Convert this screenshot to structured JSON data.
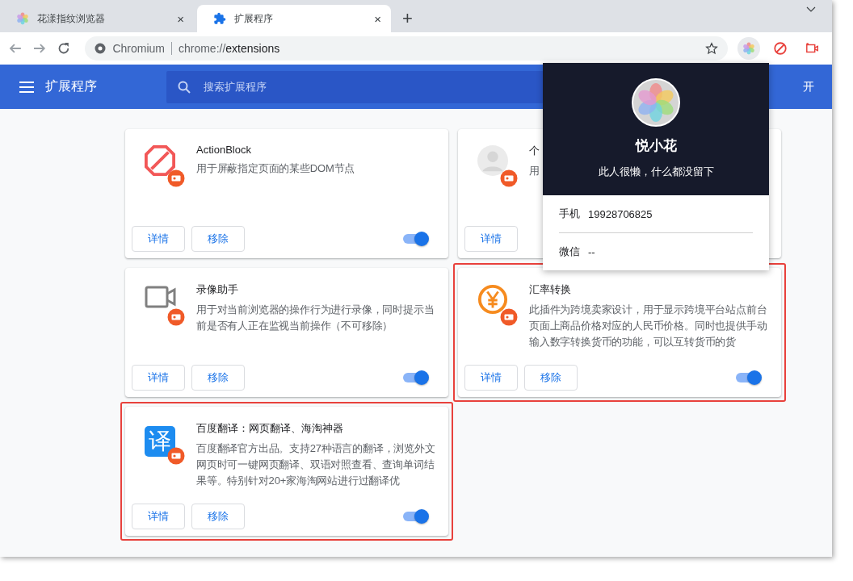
{
  "tabs": [
    {
      "title": "花漾指纹浏览器",
      "kind": "flower",
      "close_symbol": "×",
      "selected": false
    },
    {
      "title": "扩展程序",
      "kind": "puzzle",
      "close_symbol": "×",
      "selected": true
    }
  ],
  "new_tab_symbol": "+",
  "address_bar": {
    "site": "Chromium",
    "url_scheme": "chrome://",
    "url_path": "extensions"
  },
  "toolbar_extensions": [
    {
      "kind": "flower",
      "selected": true
    },
    {
      "kind": "block",
      "selected": false
    },
    {
      "kind": "camera",
      "selected": false
    }
  ],
  "header": {
    "title": "扩展程序",
    "search_placeholder": "搜索扩展程序",
    "right_text": "开"
  },
  "cards": [
    {
      "name": "ActionBlock",
      "description": "用于屏蔽指定页面的某些DOM节点",
      "kind": "block",
      "enabled": true,
      "highlighted": false,
      "buttons": [
        "详情",
        "移除"
      ]
    },
    {
      "name": "个",
      "description": "用",
      "kind": "person",
      "highlighted": false,
      "buttons": [
        "详情"
      ]
    },
    {
      "name": "录像助手",
      "description": "用于对当前浏览器的操作行为进行录像，同时提示当前是否有人正在监视当前操作（不可移除）",
      "kind": "camera",
      "enabled": true,
      "highlighted": false,
      "buttons": [
        "详情",
        "移除"
      ]
    },
    {
      "name": "汇率转换",
      "description": "此插件为跨境卖家设计，用于显示跨境平台站点前台页面上商品价格对应的人民币价格。同时也提供手动输入数字转换货币的功能，可以互转货币的货",
      "kind": "yen",
      "enabled": true,
      "highlighted": true,
      "buttons": [
        "详情",
        "移除"
      ]
    },
    {
      "name": "百度翻译：网页翻译、海淘神器",
      "description": "百度翻译官方出品。支持27种语言的翻译，浏览外文网页时可一键网页翻译、双语对照查看、查询单词结果等。特别针对20+家海淘网站进行过翻译优",
      "kind": "text",
      "icon_text": "译",
      "enabled": true,
      "highlighted": true,
      "buttons": [
        "详情",
        "移除"
      ]
    }
  ],
  "profile_popup": {
    "name": "悦小花",
    "motto": "此人很懒，什么都没留下",
    "fields": [
      {
        "label": "手机",
        "value": "19928706825"
      },
      {
        "label": "微信",
        "value": "--"
      }
    ]
  }
}
